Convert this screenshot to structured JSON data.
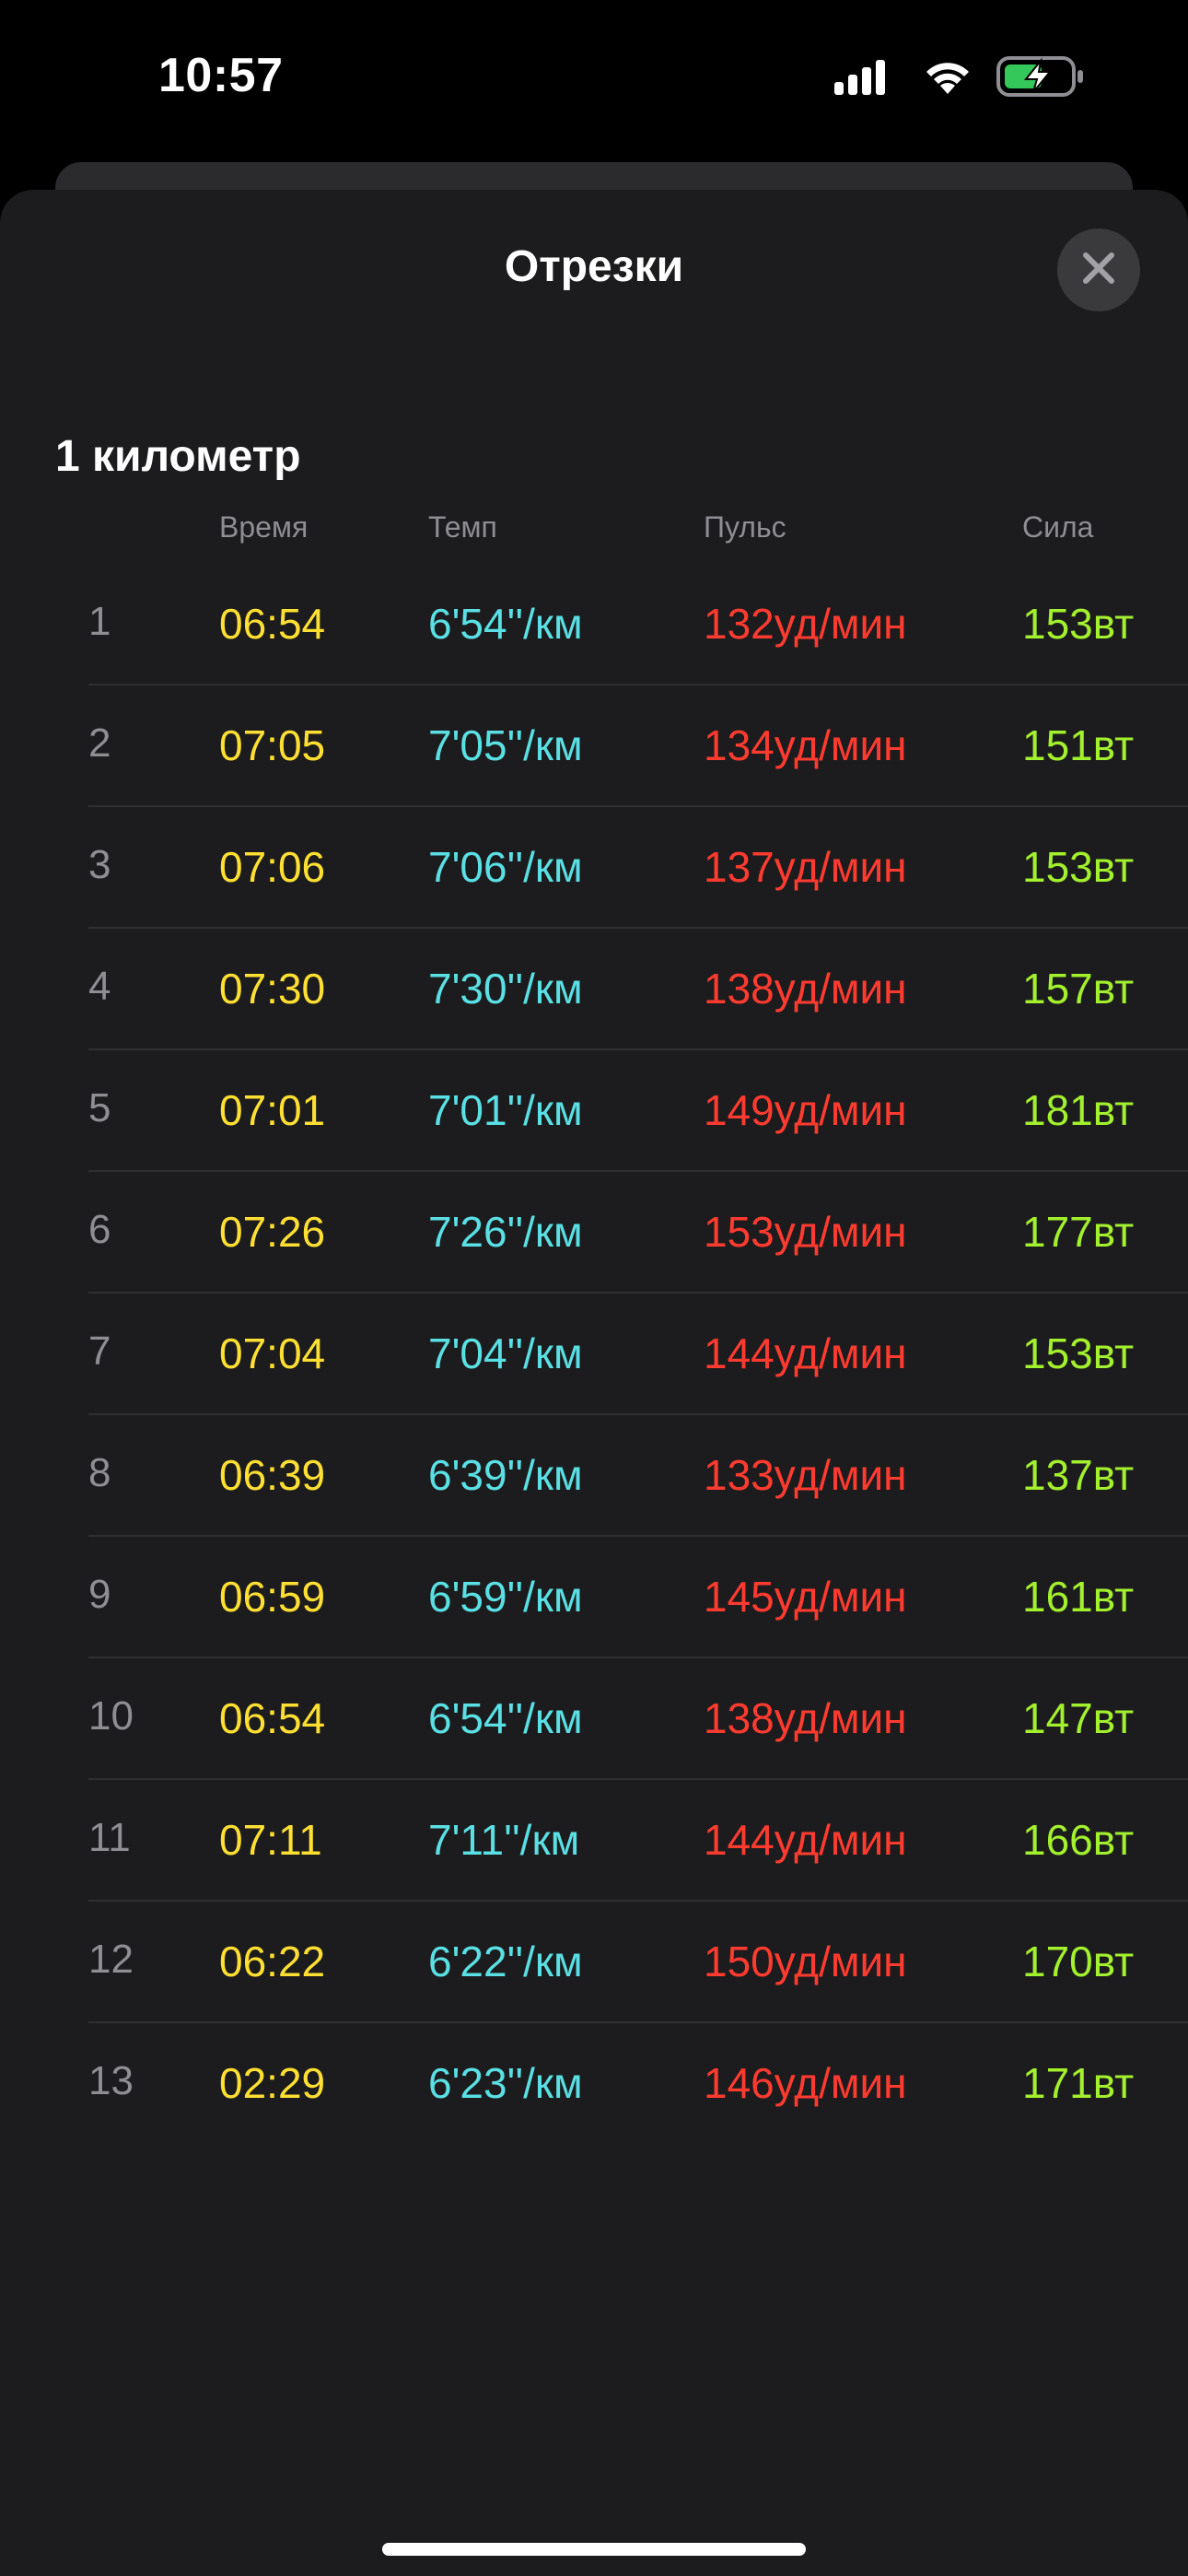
{
  "status_bar": {
    "time": "10:57",
    "icons": [
      "cellular-signal-icon",
      "wifi-icon",
      "battery-charging-icon"
    ]
  },
  "sheet": {
    "title": "Отрезки",
    "close_icon": "close-icon"
  },
  "section": {
    "title": "1 километр"
  },
  "columns": {
    "time": "Время",
    "pace": "Темп",
    "heart_rate": "Пульс",
    "power": "Сила"
  },
  "colors": {
    "time": "#ffe032",
    "pace": "#5ae0e4",
    "heart_rate": "#ff3b30",
    "power": "#a3f02d"
  },
  "splits": [
    {
      "n": "1",
      "time": "06:54",
      "pace": "6'54''/км",
      "hr": "132уд/мин",
      "power": "153вт"
    },
    {
      "n": "2",
      "time": "07:05",
      "pace": "7'05''/км",
      "hr": "134уд/мин",
      "power": "151вт"
    },
    {
      "n": "3",
      "time": "07:06",
      "pace": "7'06''/км",
      "hr": "137уд/мин",
      "power": "153вт"
    },
    {
      "n": "4",
      "time": "07:30",
      "pace": "7'30''/км",
      "hr": "138уд/мин",
      "power": "157вт"
    },
    {
      "n": "5",
      "time": "07:01",
      "pace": "7'01''/км",
      "hr": "149уд/мин",
      "power": "181вт"
    },
    {
      "n": "6",
      "time": "07:26",
      "pace": "7'26''/км",
      "hr": "153уд/мин",
      "power": "177вт"
    },
    {
      "n": "7",
      "time": "07:04",
      "pace": "7'04''/км",
      "hr": "144уд/мин",
      "power": "153вт"
    },
    {
      "n": "8",
      "time": "06:39",
      "pace": "6'39''/км",
      "hr": "133уд/мин",
      "power": "137вт"
    },
    {
      "n": "9",
      "time": "06:59",
      "pace": "6'59''/км",
      "hr": "145уд/мин",
      "power": "161вт"
    },
    {
      "n": "10",
      "time": "06:54",
      "pace": "6'54''/км",
      "hr": "138уд/мин",
      "power": "147вт"
    },
    {
      "n": "11",
      "time": "07:11",
      "pace": "7'11''/км",
      "hr": "144уд/мин",
      "power": "166вт"
    },
    {
      "n": "12",
      "time": "06:22",
      "pace": "6'22''/км",
      "hr": "150уд/мин",
      "power": "170вт"
    },
    {
      "n": "13",
      "time": "02:29",
      "pace": "6'23''/км",
      "hr": "146уд/мин",
      "power": "171вт"
    }
  ]
}
